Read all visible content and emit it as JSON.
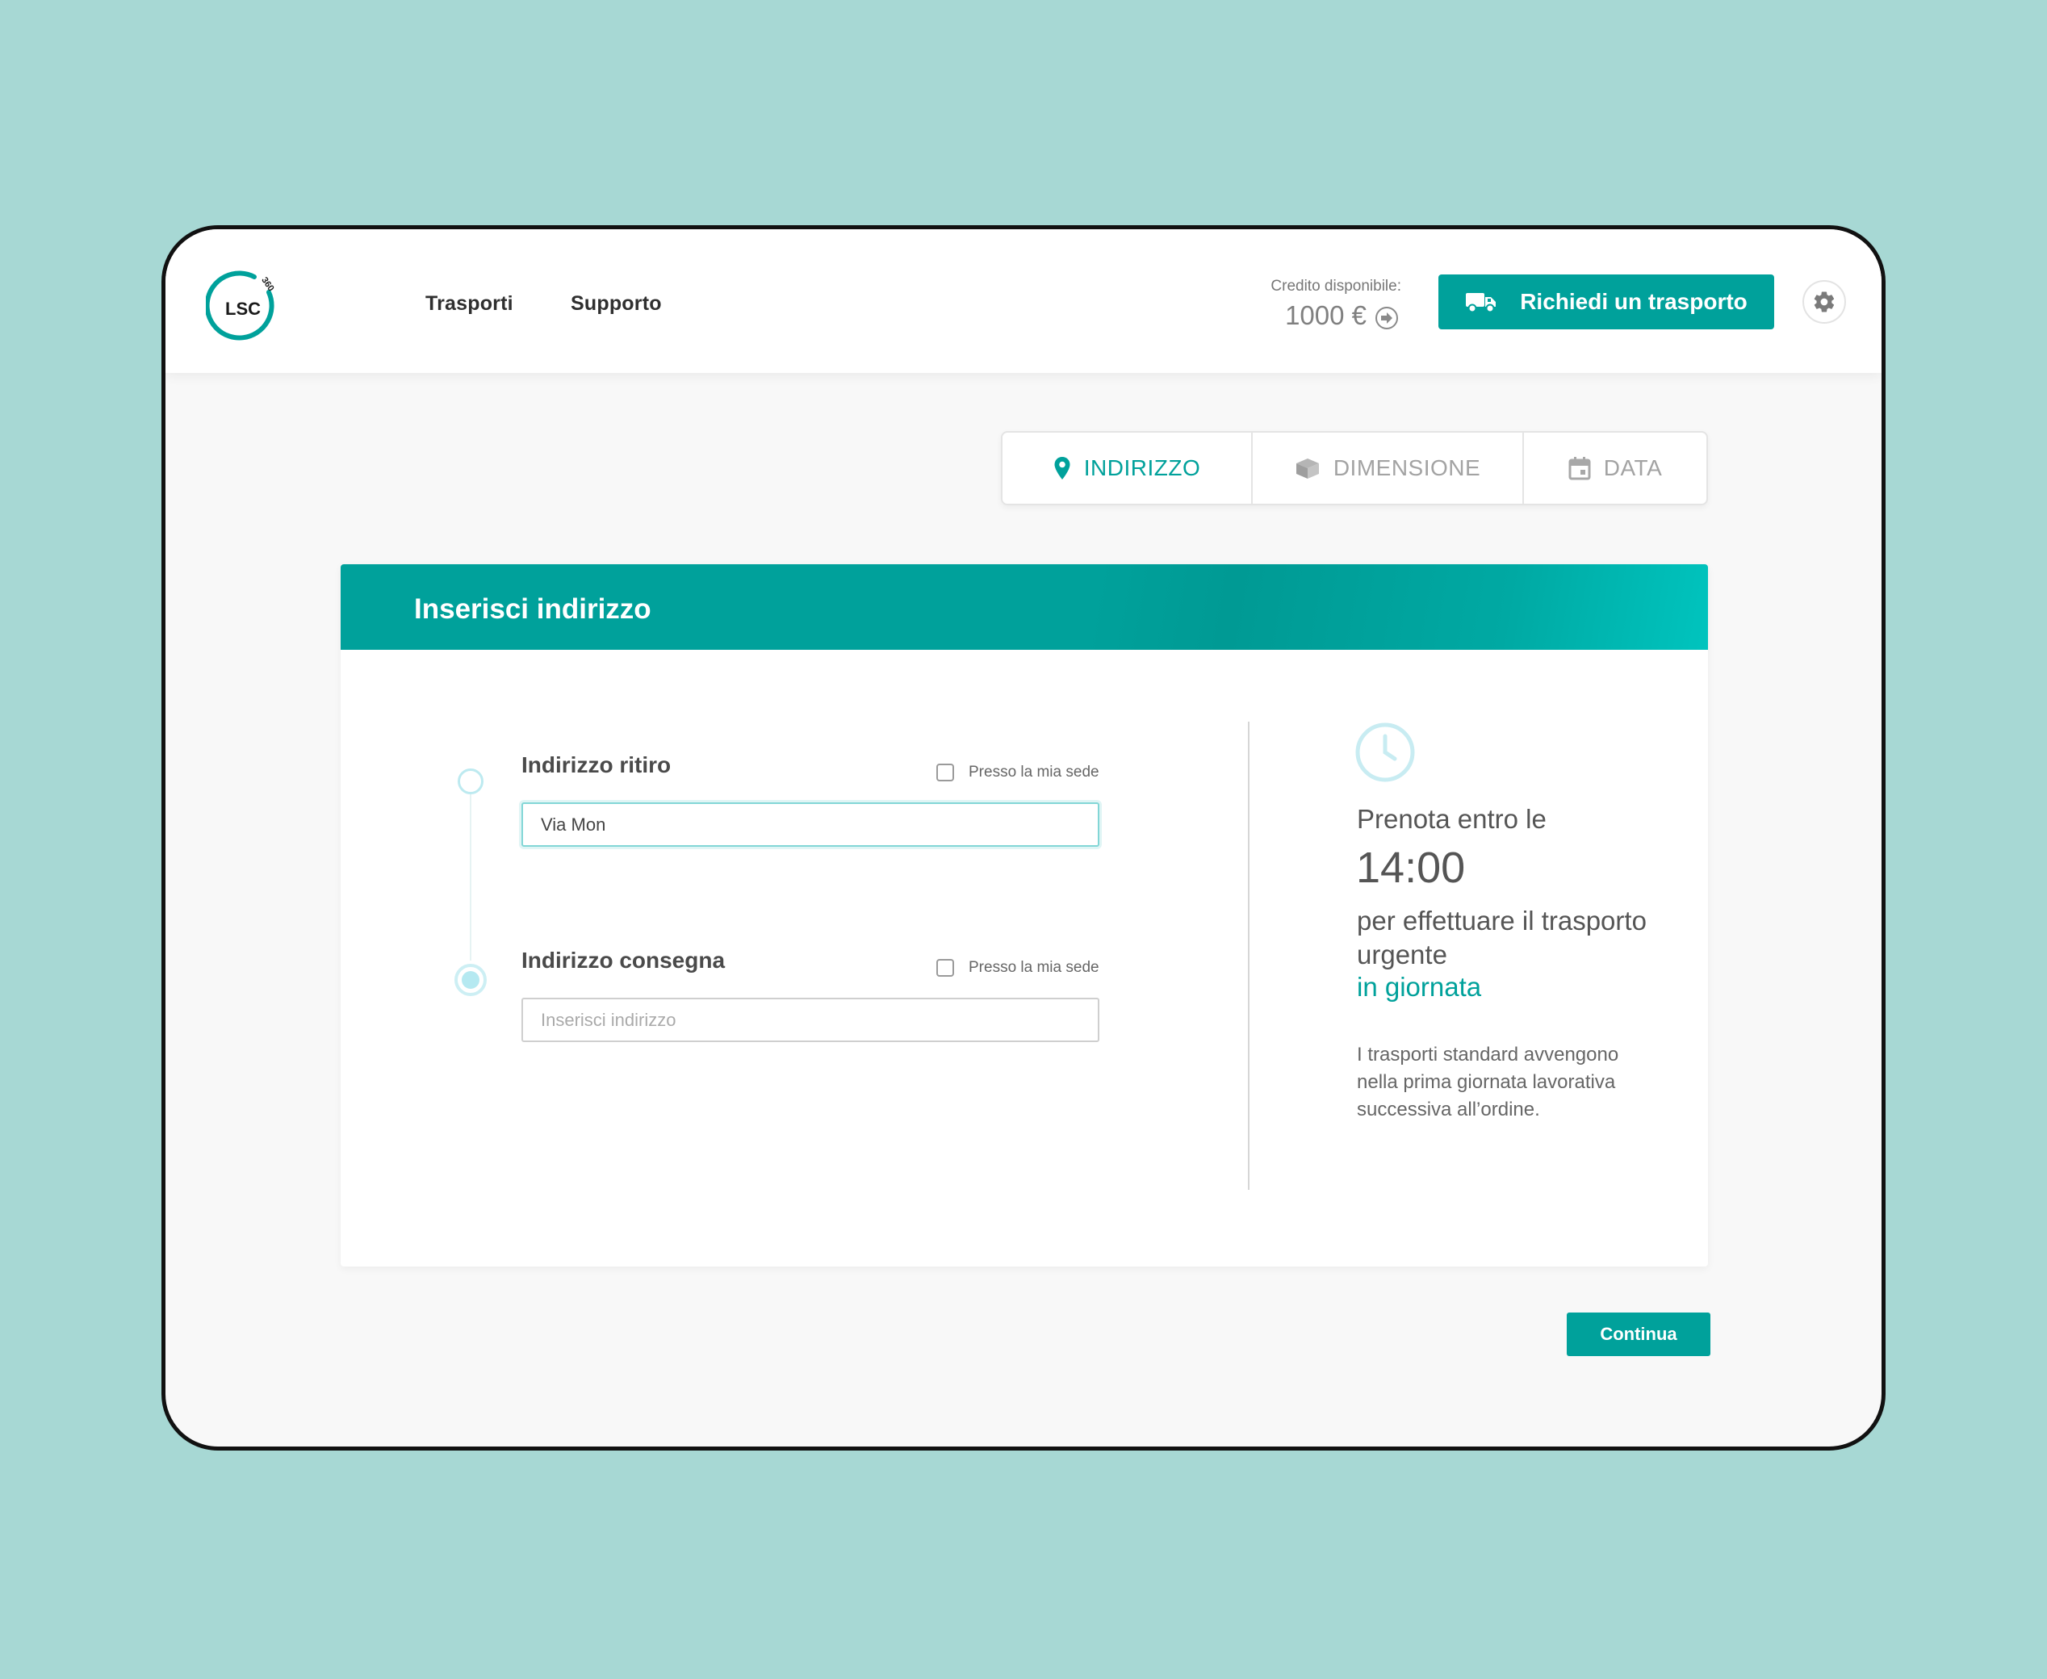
{
  "header": {
    "logo_text": "LSC",
    "logo_badge": "360",
    "nav": [
      {
        "label": "Trasporti"
      },
      {
        "label": "Supporto"
      }
    ],
    "credit_label": "Credito disponibile:",
    "credit_value": "1000 €",
    "cta_label": "Richiedi un trasporto"
  },
  "steps": [
    {
      "label": "INDIRIZZO",
      "icon": "location-pin-icon",
      "active": true
    },
    {
      "label": "DIMENSIONE",
      "icon": "box-icon",
      "active": false
    },
    {
      "label": "DATA",
      "icon": "calendar-icon",
      "active": false
    }
  ],
  "card": {
    "title": "Inserisci indirizzo",
    "pickup": {
      "label": "Indirizzo ritiro",
      "checkbox_label": "Presso la mia sede",
      "value": "Via Mon"
    },
    "delivery": {
      "label": "Indirizzo consegna",
      "checkbox_label": "Presso la mia sede",
      "placeholder": "Inserisci indirizzo"
    },
    "info": {
      "line1": "Prenota entro le",
      "time": "14:00",
      "line2": "per effettuare il trasporto urgente",
      "accent": "in giornata",
      "note": "I trasporti standard avvengono nella prima giornata lavorativa successiva all’ordine."
    }
  },
  "continue_label": "Continua",
  "colors": {
    "accent": "#00a19b",
    "background": "#a7d8d4"
  }
}
